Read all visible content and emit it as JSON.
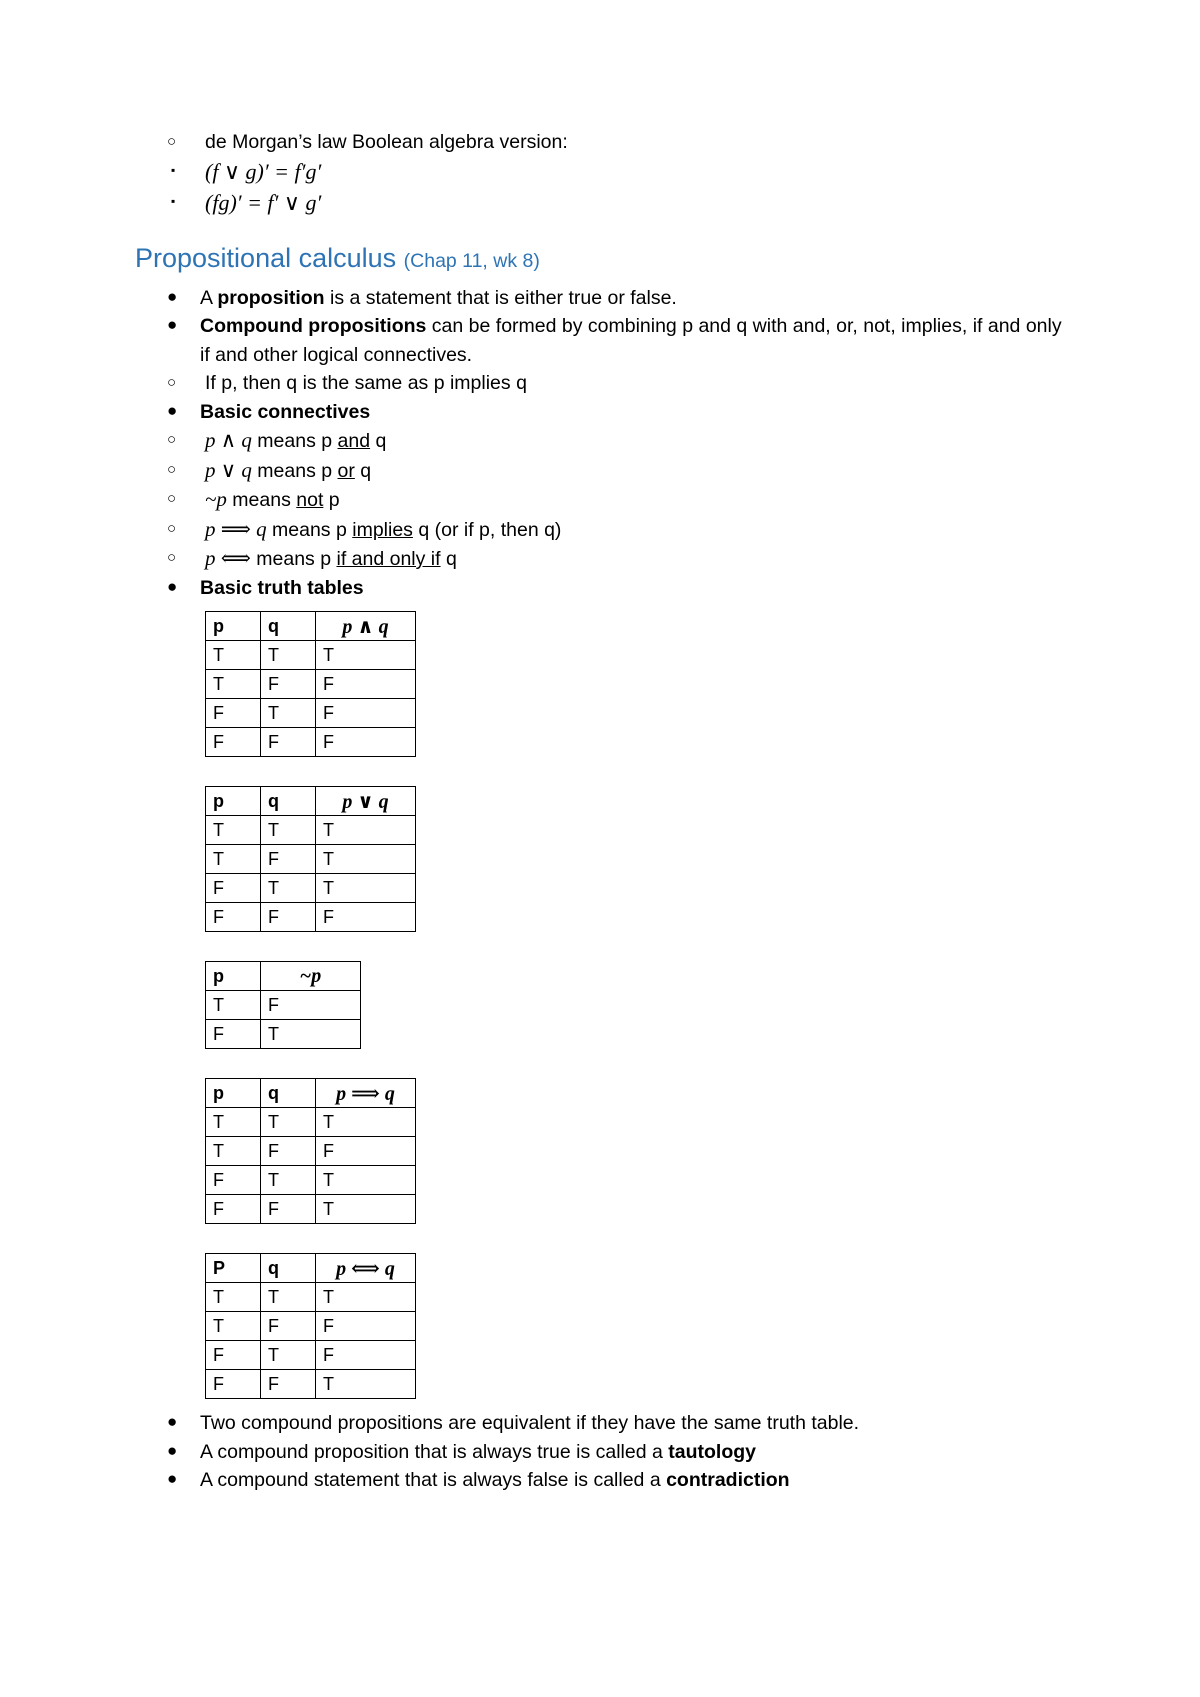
{
  "document": {
    "top_section": {
      "bullet_label": "de Morgan’s law Boolean algebra version:",
      "formulas": [
        "(f ∨ g)′ = f′g′",
        "(fg)′ = f′ ∨ g′"
      ]
    },
    "heading": {
      "title": "Propositional calculus",
      "subtitle": "(Chap 11, wk 8)",
      "color": "#2E74B5"
    },
    "bullets": {
      "proposition": {
        "lead": "A ",
        "bold": "proposition",
        "rest": " is a statement that is either true or false."
      },
      "compound": {
        "bold": "Compound propositions",
        "rest": " can be formed by combining p and q with and, or, not, implies, if and only if and other logical connectives.",
        "sub": "If p, then q is the same as p implies q"
      },
      "basic_connectives_label": "Basic connectives",
      "connectives": [
        {
          "symbol": "p ∧ q",
          "pre": " means p ",
          "underline": "and",
          "post": " q"
        },
        {
          "symbol": "p ∨ q",
          "pre": " means p ",
          "underline": "or",
          "post": " q"
        },
        {
          "symbol": "~p",
          "pre": " means ",
          "underline": "not",
          "post": " p"
        },
        {
          "symbol": "p ⟹ q",
          "pre": " means p ",
          "underline": "implies",
          "post": " q (or if p, then q)"
        },
        {
          "symbol": "p ⟺",
          "pre": " means p ",
          "underline": "if and only if",
          "post": " q"
        }
      ],
      "basic_truth_tables_label": "Basic truth tables"
    },
    "tables": [
      {
        "name": "conjunction",
        "columns": [
          "p",
          "q",
          "p ∧ q"
        ],
        "rows": [
          [
            "T",
            "T",
            "T"
          ],
          [
            "T",
            "F",
            "F"
          ],
          [
            "F",
            "T",
            "F"
          ],
          [
            "F",
            "F",
            "F"
          ]
        ]
      },
      {
        "name": "disjunction",
        "columns": [
          "p",
          "q",
          "p ∨ q"
        ],
        "rows": [
          [
            "T",
            "T",
            "T"
          ],
          [
            "T",
            "F",
            "T"
          ],
          [
            "F",
            "T",
            "T"
          ],
          [
            "F",
            "F",
            "F"
          ]
        ]
      },
      {
        "name": "negation",
        "columns": [
          "p",
          "~p"
        ],
        "rows": [
          [
            "T",
            "F"
          ],
          [
            "F",
            "T"
          ]
        ]
      },
      {
        "name": "implication",
        "columns": [
          "p",
          "q",
          "p ⟹ q"
        ],
        "rows": [
          [
            "T",
            "T",
            "T"
          ],
          [
            "T",
            "F",
            "F"
          ],
          [
            "F",
            "T",
            "T"
          ],
          [
            "F",
            "F",
            "T"
          ]
        ]
      },
      {
        "name": "biconditional",
        "columns": [
          "P",
          "q",
          "p ⟺ q"
        ],
        "rows": [
          [
            "T",
            "T",
            "T"
          ],
          [
            "T",
            "F",
            "F"
          ],
          [
            "F",
            "T",
            "F"
          ],
          [
            "F",
            "F",
            "T"
          ]
        ]
      }
    ],
    "closing_bullets": [
      {
        "text": "Two compound propositions are equivalent if they have the same truth table.",
        "bold": ""
      },
      {
        "text": "A compound proposition that is always true is called a ",
        "bold": "tautology"
      },
      {
        "text": "A compound statement that is always false is called a ",
        "bold": "contradiction"
      }
    ],
    "markers": {
      "disc": "●",
      "circle": "○",
      "square": "▪"
    }
  }
}
